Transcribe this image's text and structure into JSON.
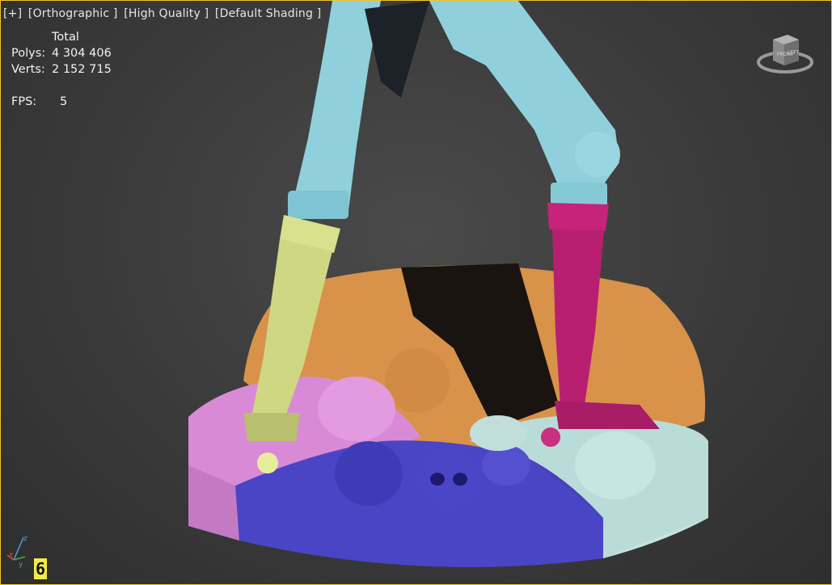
{
  "viewport_labels": {
    "menu": "[+]",
    "projection": "[Orthographic ]",
    "quality": "[High Quality ]",
    "shading": "[Default Shading ]"
  },
  "stats": {
    "header": "Total",
    "polys_label": "Polys:",
    "polys_value": "4 304 406",
    "verts_label": "Verts:",
    "verts_value": "2 152 715",
    "fps_label": "FPS:",
    "fps_value": "5"
  },
  "viewcube": {
    "face_front": "FRONT",
    "face_left": "LEFT"
  },
  "axis": {
    "x": "x",
    "y": "y",
    "z": "z"
  },
  "badge": "6",
  "colors": {
    "cyan": "#8fd0dc",
    "yellow": "#d9e08e",
    "magenta": "#c6237a",
    "pink": "#d98ad6",
    "blue": "#4a45c4",
    "orange": "#d8924a",
    "mint": "#b9dcd8",
    "accent_border": "#f1c232"
  }
}
